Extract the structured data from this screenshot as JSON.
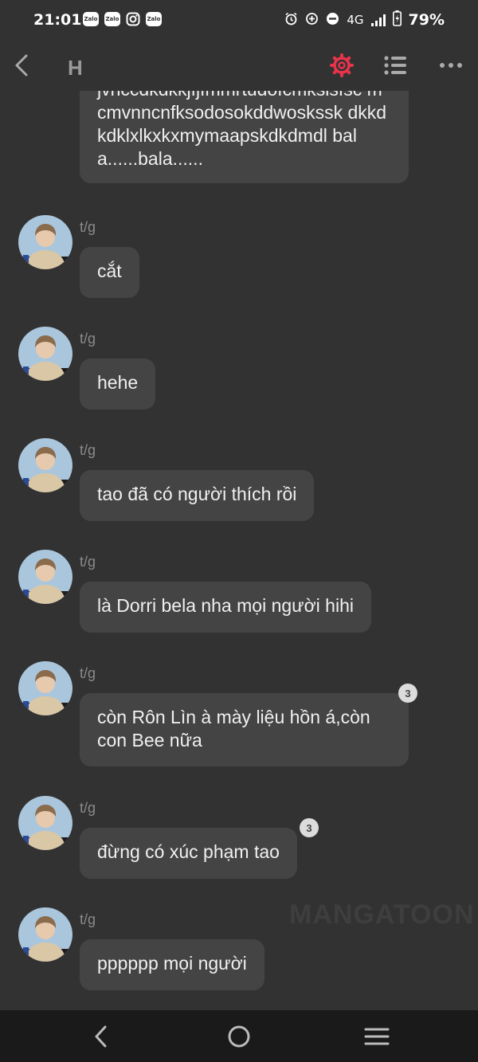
{
  "status": {
    "time": "21:01",
    "apps": [
      "Zalo",
      "Zalo",
      "instagram",
      "Zalo"
    ],
    "network": "4G",
    "battery": "79%"
  },
  "header": {
    "title": "H",
    "accent_color": "#e8334a"
  },
  "messages": [
    {
      "sender": "",
      "text": "jvhccdkdkkjfjfmmrtudofcmksisfsc mcmvnncnfksodosokddwoskssk dkkdkdklxlkxkxmymaapskdkdmdl bala......bala......",
      "badge": ""
    },
    {
      "sender": "t/g",
      "text": "cắt",
      "badge": ""
    },
    {
      "sender": "t/g",
      "text": "hehe",
      "badge": ""
    },
    {
      "sender": "t/g",
      "text": "tao đã có người thích rồi",
      "badge": ""
    },
    {
      "sender": "t/g",
      "text": "là Dorri bela nha mọi người hihi",
      "badge": ""
    },
    {
      "sender": "t/g",
      "text": "còn Rôn Lìn à mày liệu hồn á,còn con Bee nữa",
      "badge": "3"
    },
    {
      "sender": "t/g",
      "text": "đừng có xúc phạm tao",
      "badge": "3"
    },
    {
      "sender": "t/g",
      "text": "pppppp mọi người",
      "badge": ""
    }
  ],
  "watermark": "MANGATOON"
}
